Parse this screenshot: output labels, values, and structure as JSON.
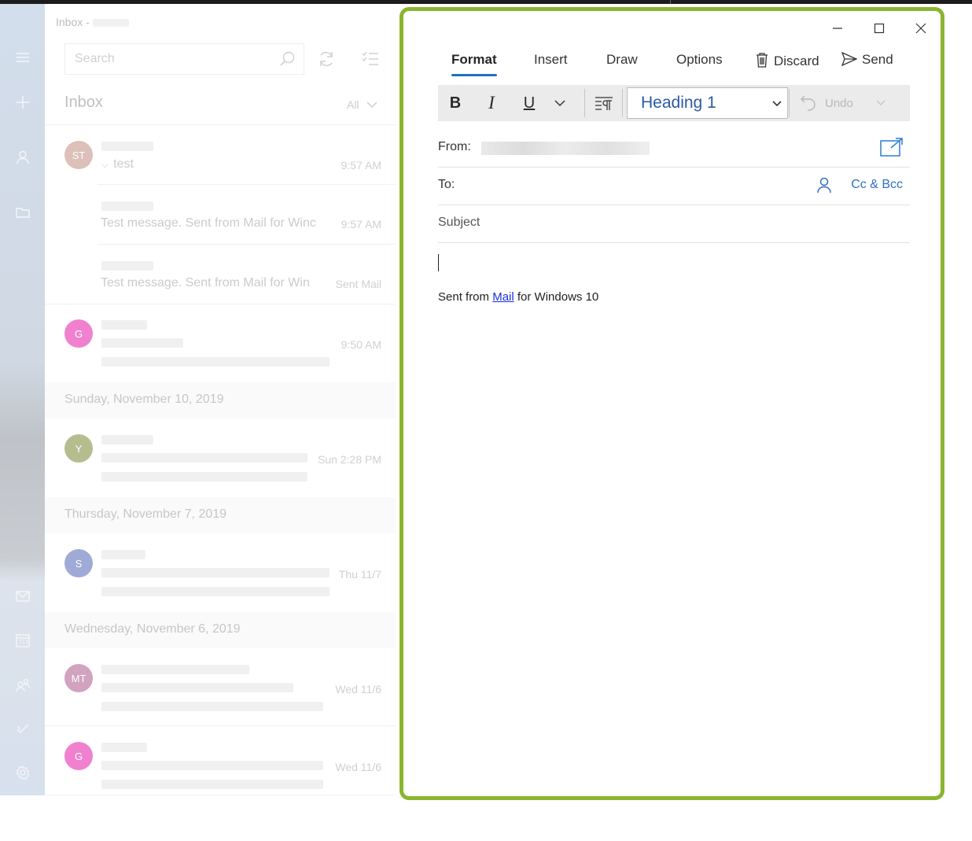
{
  "nav_rail": {
    "icons": [
      "hamburger-icon",
      "plus-icon",
      "person-icon",
      "folder-icon",
      "mail-icon",
      "calendar-icon",
      "people-icon",
      "todo-icon",
      "gear-icon"
    ]
  },
  "message_list": {
    "account_label": "Inbox -",
    "search_placeholder": "Search",
    "folder_title": "Inbox",
    "filter_label": "All",
    "items": [
      {
        "initials": "ST",
        "subject": "test",
        "time": "9:57 AM",
        "color": "#d7b6ad"
      },
      {
        "preview": "Test message. Sent from Mail for Winc",
        "time": "9:57 AM"
      },
      {
        "preview": "Test message. Sent from Mail for Win",
        "time": "Sent Mail"
      },
      {
        "initials": "G",
        "time": "9:50 AM",
        "color": "#ee6cc6"
      },
      {
        "initials": "Y",
        "time": "Sun 2:28 PM",
        "color": "#a9b27c"
      },
      {
        "initials": "S",
        "time": "Thu 11/7",
        "color": "#8f9ccf"
      },
      {
        "initials": "MT",
        "time": "Wed 11/6",
        "color": "#c993b4"
      },
      {
        "initials": "G",
        "time": "Wed 11/6",
        "color": "#ee6cc6"
      }
    ],
    "date_headers": [
      "Sunday, November 10, 2019",
      "Thursday, November 7, 2019",
      "Wednesday, November 6, 2019"
    ]
  },
  "compose": {
    "border_color": "#8ab52f",
    "tabs": [
      "Format",
      "Insert",
      "Draw",
      "Options"
    ],
    "active_tab": "Format",
    "discard_label": "Discard",
    "send_label": "Send",
    "format": {
      "bold": "B",
      "italic": "I",
      "underline": "U",
      "style_value": "Heading 1",
      "undo_label": "Undo"
    },
    "from_label": "From:",
    "to_label": "To:",
    "cc_bcc_label": "Cc & Bcc",
    "subject_placeholder": "Subject",
    "signature": {
      "before": "Sent from ",
      "link": "Mail",
      "after": " for Windows 10"
    }
  }
}
